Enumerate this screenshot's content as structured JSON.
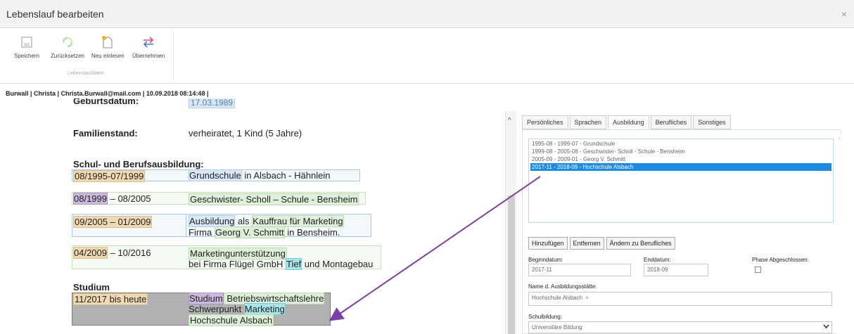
{
  "window": {
    "title": "Lebenslauf bearbeiten",
    "close_glyph": "×"
  },
  "ribbon": {
    "buttons": [
      {
        "label": "Speichern",
        "icon": "save-icon"
      },
      {
        "label": "Zurücksetzen",
        "icon": "reset-icon"
      },
      {
        "label": "Neu einlesen",
        "icon": "new-file-icon"
      },
      {
        "label": "Übernehmen",
        "icon": "transfer-icon"
      }
    ],
    "group_label": "Lebenslaufdaten"
  },
  "info_line": "Burwall | Christa | Christa.Burwall@mail.com | 10.09.2018 08:14:48 |",
  "document": {
    "birth_label": "Geburtsdatum:",
    "birth_value": "17.03.1989",
    "family_label": "Familienstand:",
    "family_value": "verheiratet, 1 Kind (5 Jahre)",
    "education_heading": "Schul- und Berufsausbildung:",
    "entries": [
      {
        "date": "08/1995-07/1999",
        "text1": "Grundschule",
        "text2": " in Alsbach - Hähnlein"
      },
      {
        "date_a": "08/1999",
        "date_b": " – 08/2005",
        "text": "Geschwister- Scholl – Schule - Bensheim"
      },
      {
        "date": "09/2005 – 01/2009",
        "t1": "Ausbildung",
        "t2": " als ",
        "t3": "Kauffrau für Marketing",
        "line2a": "Firma ",
        "line2b": "Georg V. Schmitt",
        "line2c": " in Bensheim."
      },
      {
        "date_a": "04/2009",
        "date_b": " – 10/2016",
        "line1": "Marketingunterstützung",
        "line2a": "bei Firma Flügel GmbH ",
        "line2b": "Tief",
        "line2c": " und Montagebau"
      }
    ],
    "study_heading": "Studium",
    "study": {
      "date": "11/2017 bis heute",
      "l1a": "Studium",
      "l1b": " Betriebswirtschaftslehre",
      "l2a": "Schwerpunkt ",
      "l2b": "Marketing",
      "l3": "Hochschule Alsbach"
    }
  },
  "tabs": [
    "Persönliches",
    "Sprachen",
    "Ausbildung",
    "Berufliches",
    "Sonstiges"
  ],
  "education_list": [
    "1995-08 - 1999-07 - Grundschule",
    "1999-08 - 2005-08 - Geschwister- Scholl - Schule - Bensheim",
    "2005-09 - 2009-01 - Georg V. Schmitt",
    "2017-11 - 2018-09 - Hochschule Alsbach"
  ],
  "buttons": [
    "Hinzufügen",
    "Entfernen",
    "Ändern zu Berufliches"
  ],
  "form": {
    "begin_label": "Beginndatum:",
    "begin_value": "2017-11",
    "end_label": "Enddatum:",
    "end_value": "2018-09",
    "phase_label": "Phase Abgeschlossen:",
    "phase_checked": false,
    "institution_label": "Name d. Ausbildungsstätte:",
    "institution_value": "Hochschule Alsbach",
    "institution_remove": "×",
    "schooling_label": "Schulbildung:",
    "schooling_value": "Universitäre Bildung"
  },
  "annotation_color": "#7b3fa8",
  "selection_color": "#1f8be0"
}
